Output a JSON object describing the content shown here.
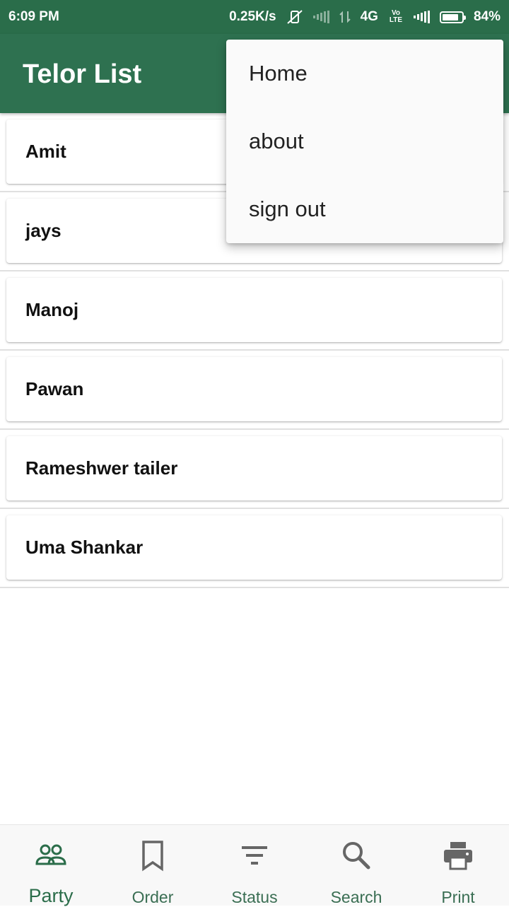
{
  "status_bar": {
    "time": "6:09 PM",
    "speed": "0.25K/s",
    "network": "4G",
    "volte": "Vo LTE",
    "battery": "84%",
    "battery_level": 0.84,
    "icons": [
      "vibrate-off-icon",
      "signal-icon",
      "data-arrows-icon",
      "volte-icon",
      "signal-icon",
      "battery-icon"
    ]
  },
  "app_bar": {
    "title": "Telor List"
  },
  "menu": {
    "items": [
      {
        "label": "Home"
      },
      {
        "label": "about"
      },
      {
        "label": "sign out"
      }
    ]
  },
  "list": {
    "items": [
      {
        "name": "Amit"
      },
      {
        "name": "jays"
      },
      {
        "name": "Manoj"
      },
      {
        "name": "Pawan"
      },
      {
        "name": "Rameshwer tailer"
      },
      {
        "name": "Uma Shankar"
      }
    ]
  },
  "bottom_nav": {
    "items": [
      {
        "label": "Party",
        "icon": "people-icon",
        "active": true
      },
      {
        "label": "Order",
        "icon": "bookmark-icon",
        "active": false
      },
      {
        "label": "Status",
        "icon": "filter-icon",
        "active": false
      },
      {
        "label": "Search",
        "icon": "search-icon",
        "active": false
      },
      {
        "label": "Print",
        "icon": "printer-icon",
        "active": false
      }
    ]
  },
  "colors": {
    "primary": "#2e7150",
    "status_bar": "#2a6d4a",
    "nav_active": "#2b6d4a"
  }
}
